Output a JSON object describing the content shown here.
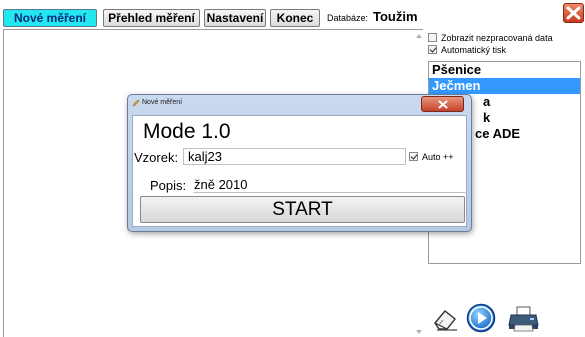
{
  "toolbar": {
    "buttons": [
      {
        "label": "Nové měření"
      },
      {
        "label": "Přehled měření"
      },
      {
        "label": "Nastavení"
      },
      {
        "label": "Konec"
      }
    ],
    "database_label": "Databáze:",
    "database_value": "Toužim"
  },
  "right_panel": {
    "show_unprocessed_label": "Zobrazit nezpracovaná data",
    "show_unprocessed_checked": false,
    "auto_print_label": "Automatický tisk",
    "auto_print_checked": true,
    "list_items": [
      {
        "label": "Pšenice"
      },
      {
        "label": "Ječmen"
      },
      {
        "label": "a"
      },
      {
        "label": "k"
      },
      {
        "label": "ce ADE"
      }
    ],
    "selected_index": 1,
    "icons": [
      "eraser-icon",
      "play-icon",
      "printer-icon"
    ]
  },
  "dialog": {
    "title": "Nové měření",
    "mode": "Mode 1.0",
    "sample_label": "Vzorek:",
    "sample_value": "kalj23",
    "auto_label": "Auto ++",
    "auto_checked": true,
    "description_label": "Popis:",
    "description_value": "žně 2010",
    "start_label": "START"
  },
  "colors": {
    "active_tab": "#22e6f0",
    "list_selection": "#3399ff",
    "dialog_frame": "#c9d9ee",
    "close_red": "#c9381c"
  }
}
